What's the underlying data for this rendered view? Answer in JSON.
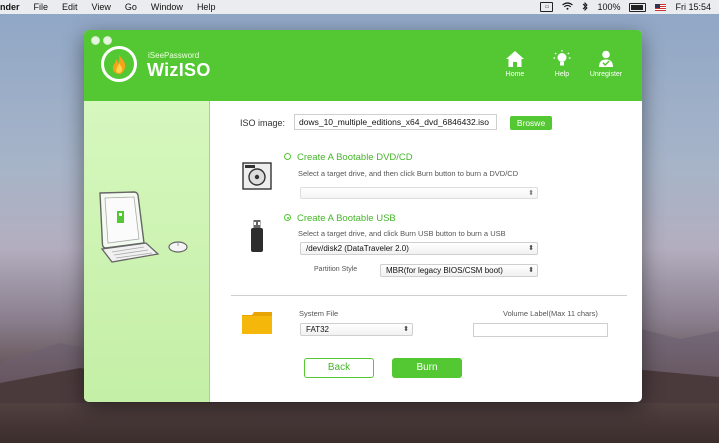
{
  "menubar": {
    "app_name": "nder",
    "items": [
      "File",
      "Edit",
      "View",
      "Go",
      "Window",
      "Help"
    ],
    "status": {
      "battery": "100%",
      "clock": "Fri 15:54"
    }
  },
  "app": {
    "brand_small": "iSeePassword",
    "brand_big": "WizISO",
    "nav": {
      "home": "Home",
      "help": "Help",
      "unregister": "Unregister"
    }
  },
  "iso": {
    "label": "ISO image:",
    "value": "dows_10_multiple_editions_x64_dvd_6846432.iso",
    "browse_label": "Broswe"
  },
  "dvd": {
    "title": "Create A Bootable DVD/CD",
    "hint": "Select a target drive, and then click Burn button to burn a DVD/CD",
    "drive": "",
    "selected": false
  },
  "usb": {
    "title": "Create A Bootable USB",
    "hint": "Select a target drive, and click Burn USB button to burn a USB",
    "drive": "/dev/disk2  (DataTraveler 2.0)",
    "partition_label": "Partition Style",
    "partition_value": "MBR(for legacy BIOS/CSM boot)",
    "selected": true
  },
  "filesystem": {
    "label": "System File",
    "value": "FAT32"
  },
  "volume": {
    "label": "Volume Label(Max 11 chars)",
    "value": ""
  },
  "actions": {
    "back_label": "Back",
    "burn_label": "Burn"
  },
  "colors": {
    "accent": "#54c832",
    "sidebar": "#c9f1ad",
    "folder": "#f2b705"
  }
}
